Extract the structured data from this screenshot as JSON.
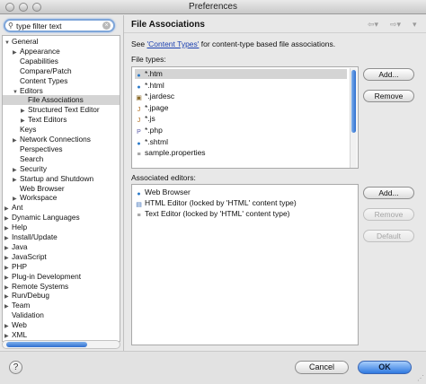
{
  "window": {
    "title": "Preferences"
  },
  "search": {
    "value": "type filter text"
  },
  "tree": [
    {
      "label": "General",
      "level": 0,
      "expanded": true
    },
    {
      "label": "Appearance",
      "level": 1,
      "expanded": false
    },
    {
      "label": "Capabilities",
      "level": 1
    },
    {
      "label": "Compare/Patch",
      "level": 1
    },
    {
      "label": "Content Types",
      "level": 1
    },
    {
      "label": "Editors",
      "level": 1,
      "expanded": true
    },
    {
      "label": "File Associations",
      "level": 2,
      "selected": true
    },
    {
      "label": "Structured Text Editor",
      "level": 2,
      "expanded": false
    },
    {
      "label": "Text Editors",
      "level": 2,
      "expanded": false
    },
    {
      "label": "Keys",
      "level": 1
    },
    {
      "label": "Network Connections",
      "level": 1,
      "expanded": false
    },
    {
      "label": "Perspectives",
      "level": 1
    },
    {
      "label": "Search",
      "level": 1
    },
    {
      "label": "Security",
      "level": 1,
      "expanded": false
    },
    {
      "label": "Startup and Shutdown",
      "level": 1,
      "expanded": false
    },
    {
      "label": "Web Browser",
      "level": 1
    },
    {
      "label": "Workspace",
      "level": 1,
      "expanded": false
    },
    {
      "label": "Ant",
      "level": 0,
      "expanded": false
    },
    {
      "label": "Dynamic Languages",
      "level": 0,
      "expanded": false
    },
    {
      "label": "Help",
      "level": 0,
      "expanded": false
    },
    {
      "label": "Install/Update",
      "level": 0,
      "expanded": false
    },
    {
      "label": "Java",
      "level": 0,
      "expanded": false
    },
    {
      "label": "JavaScript",
      "level": 0,
      "expanded": false
    },
    {
      "label": "PHP",
      "level": 0,
      "expanded": false
    },
    {
      "label": "Plug-in Development",
      "level": 0,
      "expanded": false
    },
    {
      "label": "Remote Systems",
      "level": 0,
      "expanded": false
    },
    {
      "label": "Run/Debug",
      "level": 0,
      "expanded": false
    },
    {
      "label": "Team",
      "level": 0,
      "expanded": false
    },
    {
      "label": "Validation",
      "level": 0
    },
    {
      "label": "Web",
      "level": 0,
      "expanded": false
    },
    {
      "label": "XML",
      "level": 0,
      "expanded": false
    }
  ],
  "page": {
    "title": "File Associations",
    "desc_prefix": "See ",
    "desc_link": "'Content Types'",
    "desc_suffix": " for content-type based file associations.",
    "file_types_label": "File types:",
    "assoc_label": "Associated editors:"
  },
  "file_types": [
    {
      "label": "*.htm",
      "icon": "globe-file-icon",
      "selected": true
    },
    {
      "label": "*.html",
      "icon": "globe-file-icon"
    },
    {
      "label": "*.jardesc",
      "icon": "jar-file-icon"
    },
    {
      "label": "*.jpage",
      "icon": "java-file-icon"
    },
    {
      "label": "*.js",
      "icon": "js-file-icon"
    },
    {
      "label": "*.php",
      "icon": "php-file-icon"
    },
    {
      "label": "*.shtml",
      "icon": "globe-file-icon"
    },
    {
      "label": "sample.properties",
      "icon": "properties-file-icon"
    }
  ],
  "editors": [
    {
      "label": "Web Browser",
      "icon": "globe-icon"
    },
    {
      "label": "HTML Editor (locked by 'HTML' content type)",
      "icon": "document-icon"
    },
    {
      "label": "Text Editor (locked by 'HTML' content type)",
      "icon": "text-file-icon"
    }
  ],
  "buttons": {
    "add_file": "Add...",
    "remove_file": "Remove",
    "add_editor": "Add...",
    "remove_editor": "Remove",
    "default_editor": "Default",
    "cancel": "Cancel",
    "ok": "OK",
    "help": "?"
  },
  "colors": {
    "accent": "#2f79e0",
    "link": "#1a3fb0"
  }
}
